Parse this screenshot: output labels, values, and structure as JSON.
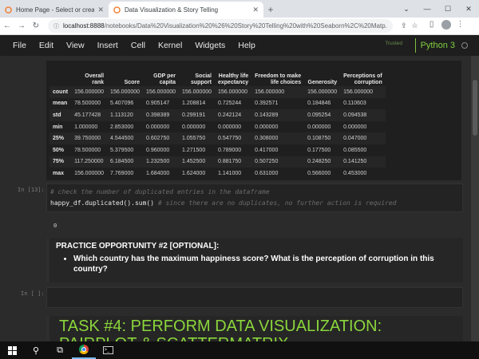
{
  "browser": {
    "tabs": [
      {
        "title": "Home Page - Select or create a n",
        "active": false
      },
      {
        "title": "Data Visualization & Story Telling",
        "active": true
      }
    ],
    "new_tab": "+",
    "url_host": "localhost:8888",
    "url_path": "/notebooks/Data%20Visualization%20%26%20Story%20Telling%20with%20Seaborn%2C%20Matp..."
  },
  "menu": {
    "items": [
      "File",
      "Edit",
      "View",
      "Insert",
      "Cell",
      "Kernel",
      "Widgets",
      "Help"
    ],
    "trusted": "Trusted",
    "kernel": "Python 3"
  },
  "describe_table": {
    "columns": [
      "Overall rank",
      "Score",
      "GDP per capita",
      "Social support",
      "Healthy life expectancy",
      "Freedom to make life choices",
      "Generosity",
      "Perceptions of corruption"
    ],
    "column_lines": [
      [
        "Overall",
        "rank"
      ],
      [
        "Score"
      ],
      [
        "GDP per",
        "capita"
      ],
      [
        "Social",
        "support"
      ],
      [
        "Healthy life",
        "expectancy"
      ],
      [
        "Freedom to make",
        "life choices"
      ],
      [
        "Generosity"
      ],
      [
        "Perceptions of",
        "corruption"
      ]
    ],
    "rows": [
      {
        "index": "count",
        "values": [
          "156.000000",
          "156.000000",
          "156.000000",
          "156.000000",
          "156.000000",
          "156.000000",
          "156.000000",
          "156.000000"
        ]
      },
      {
        "index": "mean",
        "values": [
          "78.500000",
          "5.407096",
          "0.905147",
          "1.208814",
          "0.725244",
          "0.392571",
          "0.184846",
          "0.110603"
        ]
      },
      {
        "index": "std",
        "values": [
          "45.177428",
          "1.113120",
          "0.398389",
          "0.299191",
          "0.242124",
          "0.143289",
          "0.095254",
          "0.094538"
        ]
      },
      {
        "index": "min",
        "values": [
          "1.000000",
          "2.853000",
          "0.000000",
          "0.000000",
          "0.000000",
          "0.000000",
          "0.000000",
          "0.000000"
        ]
      },
      {
        "index": "25%",
        "values": [
          "39.750000",
          "4.544500",
          "0.602750",
          "1.055750",
          "0.547750",
          "0.308000",
          "0.108750",
          "0.047000"
        ]
      },
      {
        "index": "50%",
        "values": [
          "78.500000",
          "5.379500",
          "0.960000",
          "1.271500",
          "0.789000",
          "0.417000",
          "0.177500",
          "0.085500"
        ]
      },
      {
        "index": "75%",
        "values": [
          "117.250000",
          "6.184500",
          "1.232500",
          "1.452500",
          "0.881750",
          "0.507250",
          "0.248250",
          "0.141250"
        ]
      },
      {
        "index": "max",
        "values": [
          "156.000000",
          "7.769000",
          "1.684000",
          "1.624000",
          "1.141000",
          "0.631000",
          "0.566000",
          "0.453000"
        ]
      }
    ]
  },
  "cell13": {
    "prompt": "In [13]:",
    "comment": "# check the number of duplicated entries in the dataframe",
    "code": "happy_df.duplicated().sum()",
    "inline_comment": "# since there are no duplicates, no further action is required",
    "output": "0"
  },
  "practice": {
    "heading": "PRACTICE OPPORTUNITY #2 [OPTIONAL]:",
    "bullet": "Which country has the maximum happiness score? What is the perception of corruption in this country?"
  },
  "empty_cell": {
    "prompt": "In [ ]:"
  },
  "task": {
    "line1": "TASK #4: PERFORM DATA VISUALIZATION:",
    "line2": "PAIRPLOT & SCATTERMATRIX"
  }
}
